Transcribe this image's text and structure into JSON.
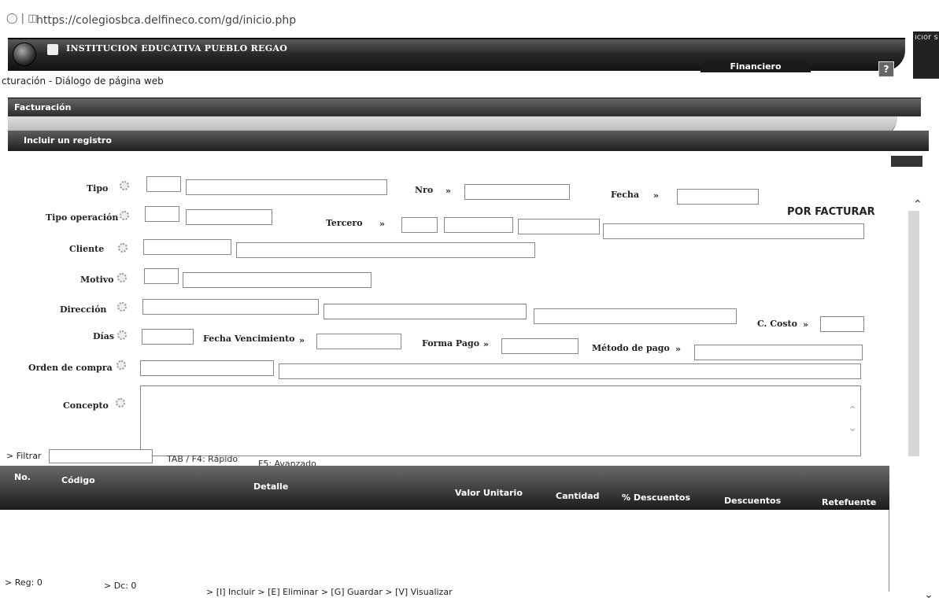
{
  "browser": {
    "url": "https://colegiosbca.delfineco.com/gd/inicio.php",
    "corner_text": "ıcıor s"
  },
  "app": {
    "institution": "INSTITUCION EDUCATIVA PUEBLO REGAO",
    "module": "Financiero",
    "help": "?"
  },
  "dialog": {
    "title": "cturación - Diálogo de página web"
  },
  "sections": {
    "facturacion": "Facturación",
    "incluir": "Incluir un registro"
  },
  "form": {
    "tipo": "Tipo",
    "nro": "Nro",
    "fecha": "Fecha",
    "tipo_operacion": "Tipo operación",
    "tercero": "Tercero",
    "cliente": "Cliente",
    "motivo": "Motivo",
    "direccion": "Dirección",
    "c_costo": "C. Costo",
    "dias": "Días",
    "fecha_vencimiento": "Fecha Vencimiento",
    "forma_pago": "Forma Pago",
    "metodo_pago": "Método de pago",
    "orden_compra": "Orden de compra",
    "concepto": "Concepto",
    "arrow": "»",
    "status": "POR FACTURAR"
  },
  "filter": {
    "label": "> Filtrar",
    "tab_hint": "TAB / F4: Rápido",
    "f5_hint": "F5: Avanzado"
  },
  "table": {
    "columns": [
      "No.",
      "Código",
      "Detalle",
      "Valor Unitario",
      "Cantidad",
      "% Descuentos",
      "Descuentos",
      "Retefuente"
    ]
  },
  "footer": {
    "reg": "> Reg: 0",
    "dc": "> Dc: 0",
    "actions": "> [I] Incluir  > [E] Eliminar  > [G] Guardar  > [V] Visualizar"
  }
}
